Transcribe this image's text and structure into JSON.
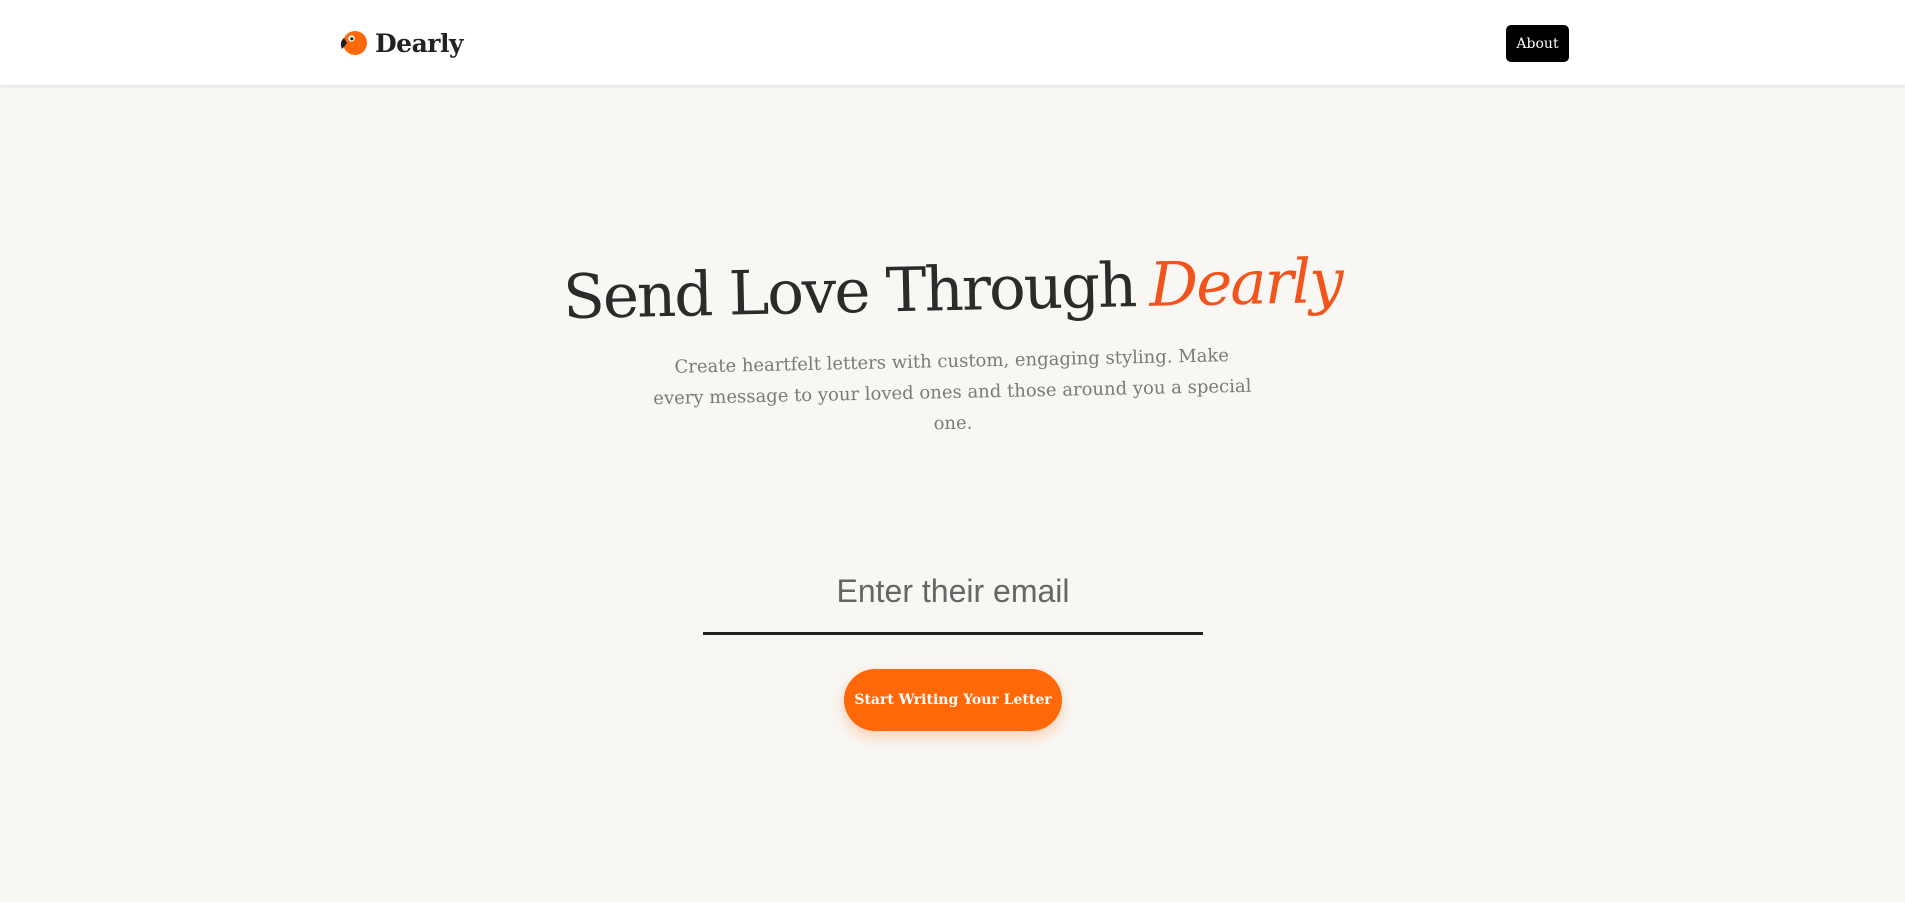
{
  "header": {
    "brand_name": "Dearly",
    "logo_icon": "parrot-head-icon",
    "about_label": "About"
  },
  "hero": {
    "title_plain": "Send Love Through",
    "title_accent": "Dearly",
    "subtitle": "Create heartfelt letters with custom, engaging styling. Make every message to your loved ones and those around you a special one."
  },
  "form": {
    "email_placeholder": "Enter their email",
    "email_value": "",
    "submit_label": "Start Writing Your Letter"
  },
  "colors": {
    "accent": "#f1541c",
    "cta": "#ff6809",
    "background": "#f8f7f3",
    "dark": "#000000"
  }
}
